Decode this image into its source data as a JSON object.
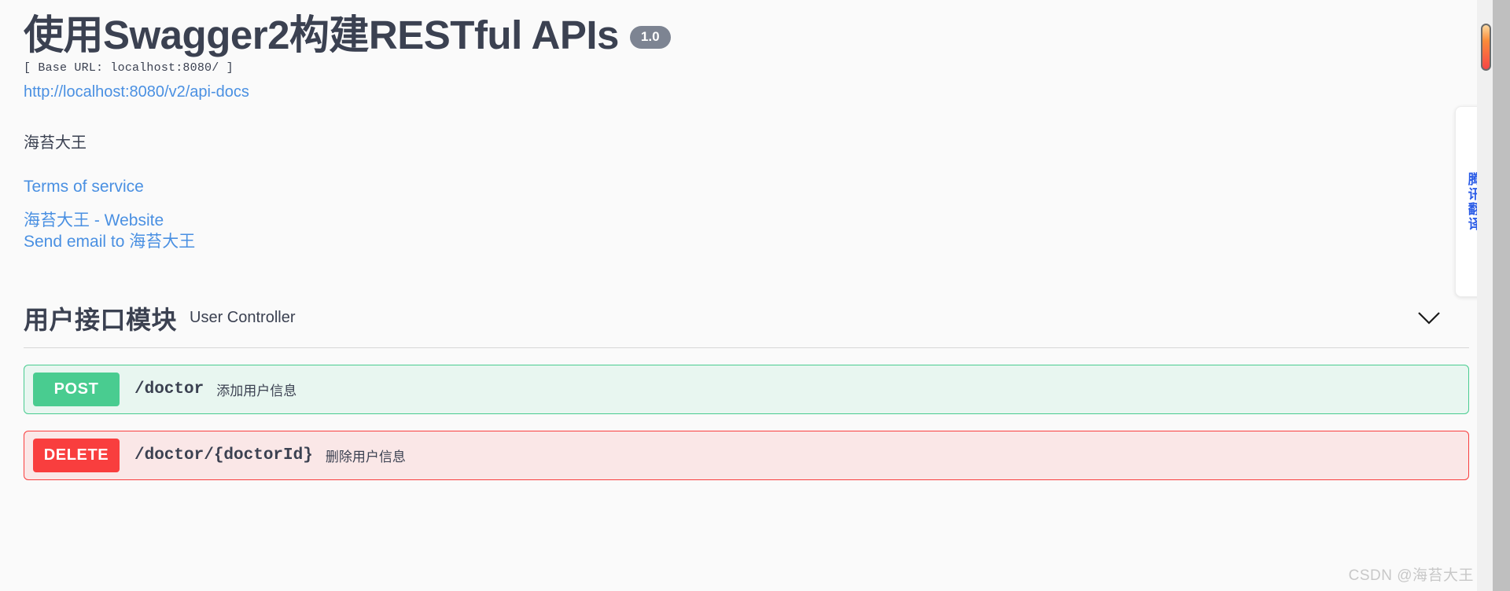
{
  "app": {
    "background_color": "#fafafa",
    "accent_link_color": "#4a90e2"
  },
  "header": {
    "title": "使用Swagger2构建RESTful APIs",
    "version": "1.0",
    "base_url_label": "[ Base URL: localhost:8080/ ]",
    "docs_url": "http://localhost:8080/v2/api-docs",
    "description": "海苔大王",
    "terms_of_service": "Terms of service",
    "contact_website": "海苔大王 - Website",
    "contact_email": "Send email to 海苔大王"
  },
  "tag": {
    "name": "用户接口模块",
    "subtitle": "User Controller",
    "expand_icon": "chevron-down-icon"
  },
  "operations": [
    {
      "method": "POST",
      "method_color": "#49cc90",
      "background_color": "#e8f6f0",
      "path": "/doctor",
      "summary": "添加用户信息"
    },
    {
      "method": "DELETE",
      "method_color": "#f93e3e",
      "background_color": "#fae7e7",
      "path": "/doctor/{doctorId}",
      "summary": "删除用户信息"
    }
  ],
  "translate_widget": {
    "label": "腾讯翻译",
    "text_color": "#2b5ce6"
  },
  "watermark": {
    "text": "CSDN @海苔大王"
  }
}
